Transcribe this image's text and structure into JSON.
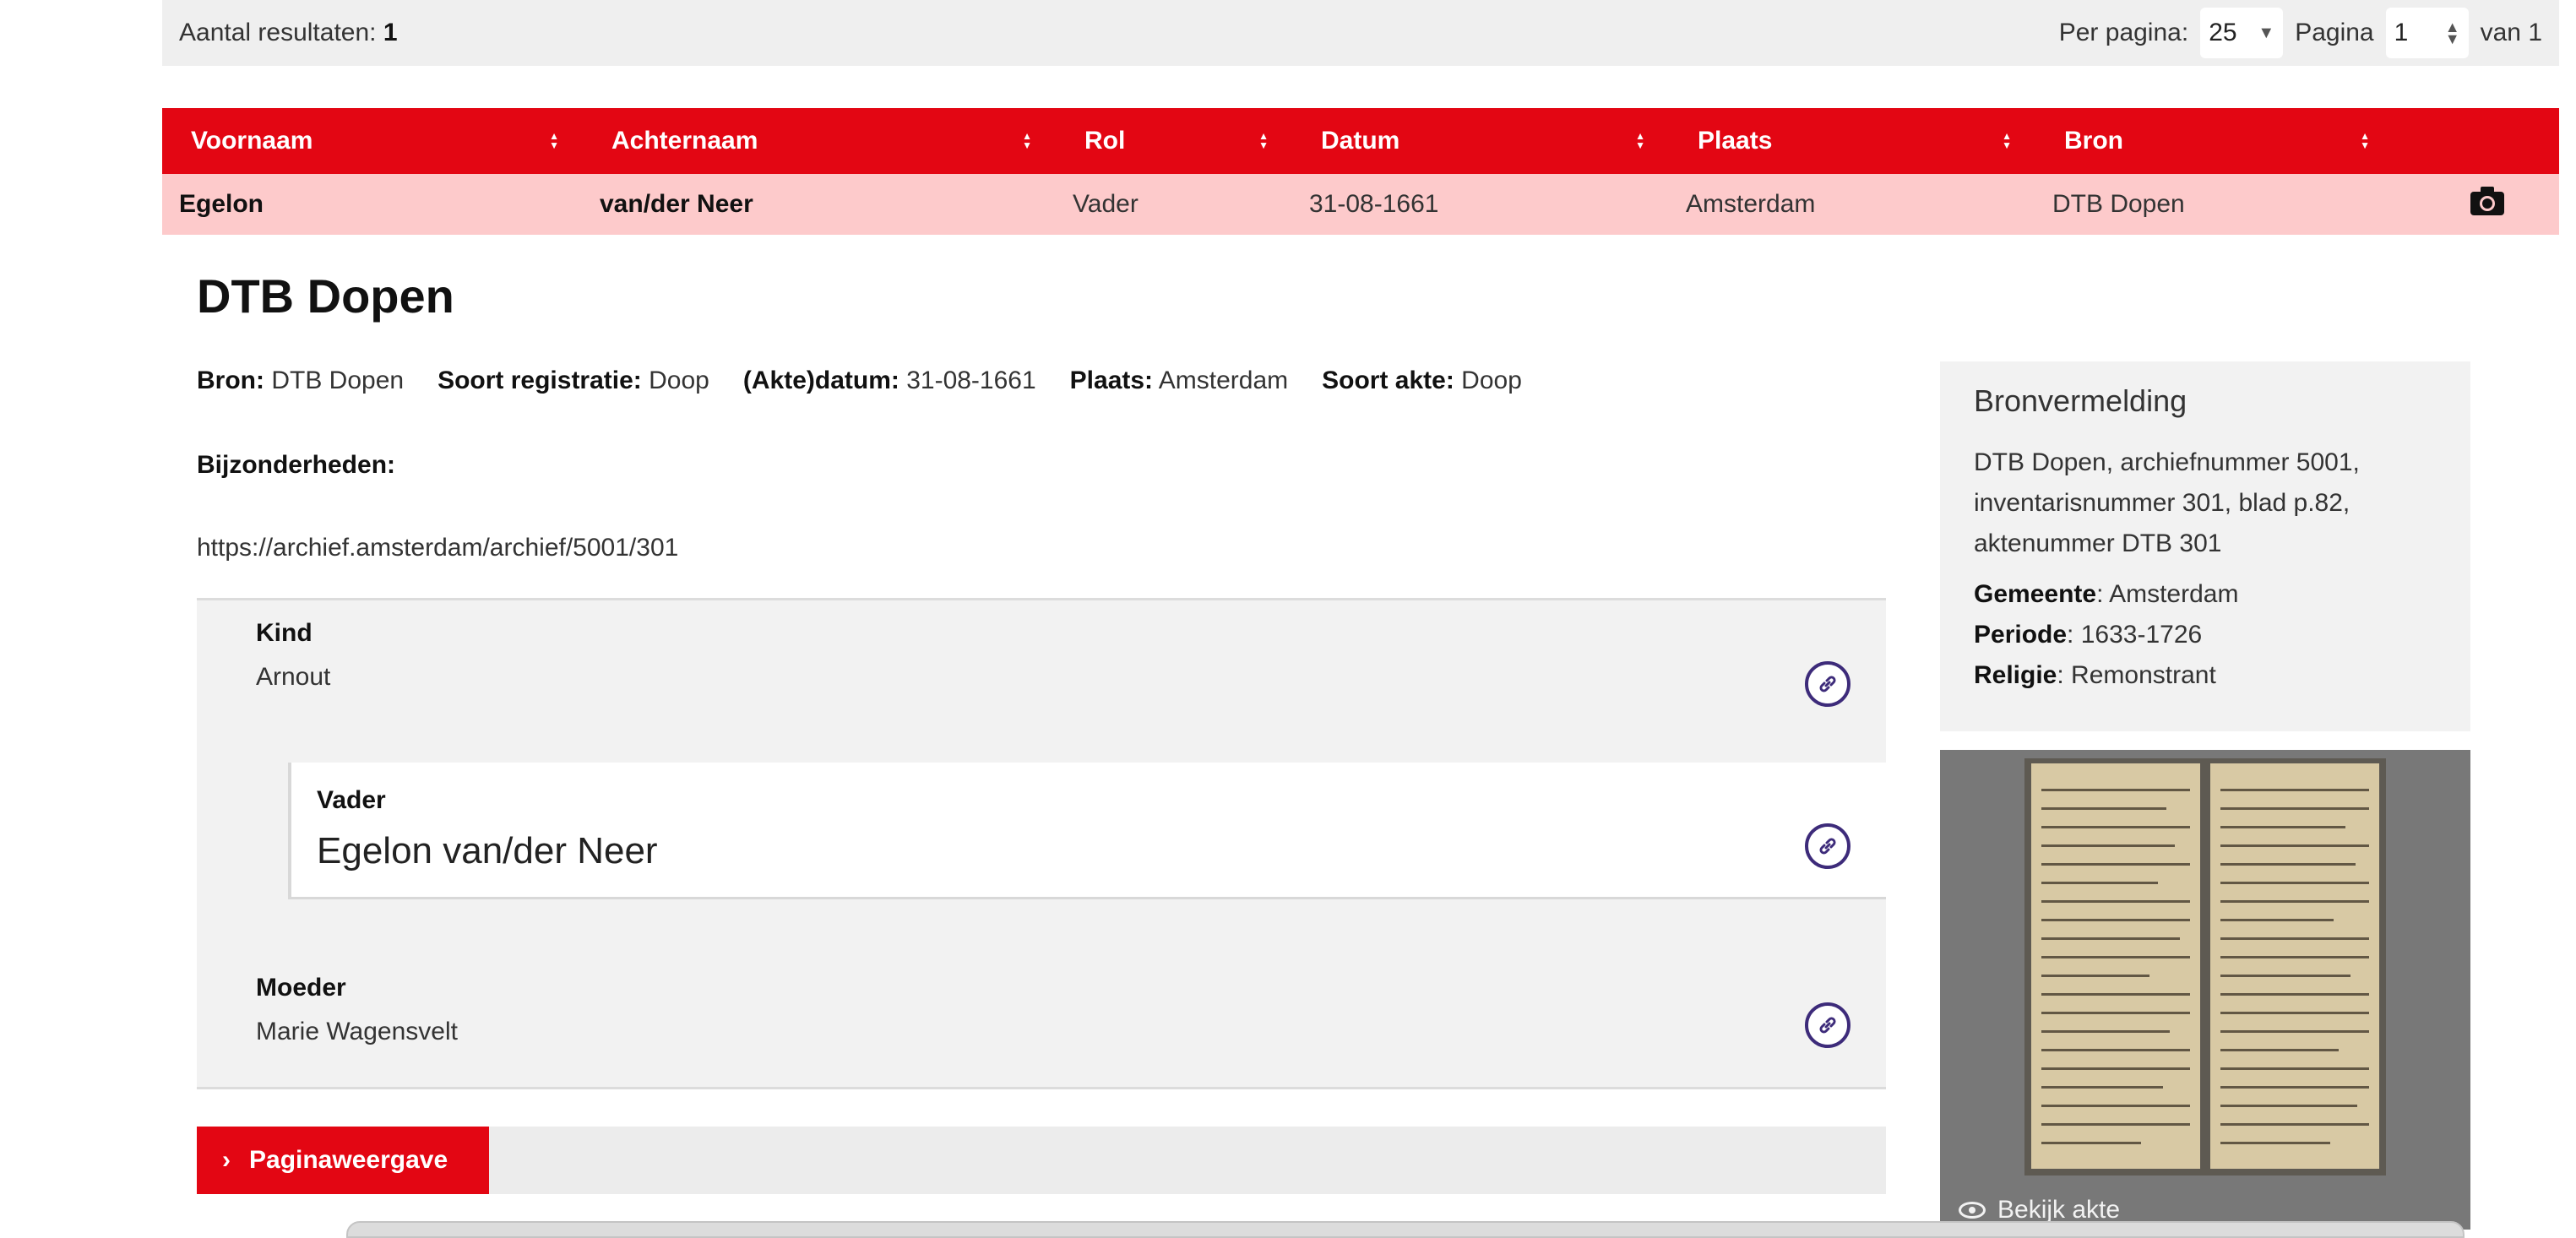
{
  "results": {
    "count_label": "Aantal resultaten:",
    "count_value": "1",
    "per_page_label": "Per pagina:",
    "per_page_value": "25",
    "page_label": "Pagina",
    "page_value": "1",
    "of_label": "van 1"
  },
  "table": {
    "headers": [
      "Voornaam",
      "Achternaam",
      "Rol",
      "Datum",
      "Plaats",
      "Bron"
    ],
    "row": {
      "voornaam": "Egelon",
      "achternaam": "van/der Neer",
      "rol": "Vader",
      "datum": "31-08-1661",
      "plaats": "Amsterdam",
      "bron": "DTB Dopen"
    }
  },
  "detail": {
    "title": "DTB Dopen",
    "meta": {
      "bron_label": "Bron:",
      "bron_value": "DTB Dopen",
      "soort_label": "Soort registratie:",
      "soort_value": "Doop",
      "datum_label": "(Akte)datum:",
      "datum_value": "31-08-1661",
      "plaats_label": "Plaats:",
      "plaats_value": "Amsterdam",
      "akte_label": "Soort akte:",
      "akte_value": "Doop"
    },
    "bijzonderheden_label": "Bijzonderheden:",
    "url": "https://archief.amsterdam/archief/5001/301",
    "persons": {
      "kind_role": "Kind",
      "kind_name": "Arnout",
      "vader_role": "Vader",
      "vader_name": "Egelon van/der Neer",
      "moeder_role": "Moeder",
      "moeder_name": "Marie Wagensvelt"
    },
    "pagina_button": "Paginaweergave"
  },
  "bronvermelding": {
    "title": "Bronvermelding",
    "desc": "DTB Dopen, archiefnummer 5001, inventarisnummer 301, blad p.82, aktenummer DTB 301",
    "gemeente_label": "Gemeente",
    "gemeente_value": ": Amsterdam",
    "periode_label": "Periode",
    "periode_value": ": 1633-1726",
    "religie_label": "Religie",
    "religie_value": ": Remonstrant"
  },
  "scan": {
    "bekijk_label": "Bekijk akte"
  },
  "colors": {
    "accent_red": "#e30613",
    "row_pink": "#fdcacb",
    "link_purple": "#3d2b7a"
  }
}
